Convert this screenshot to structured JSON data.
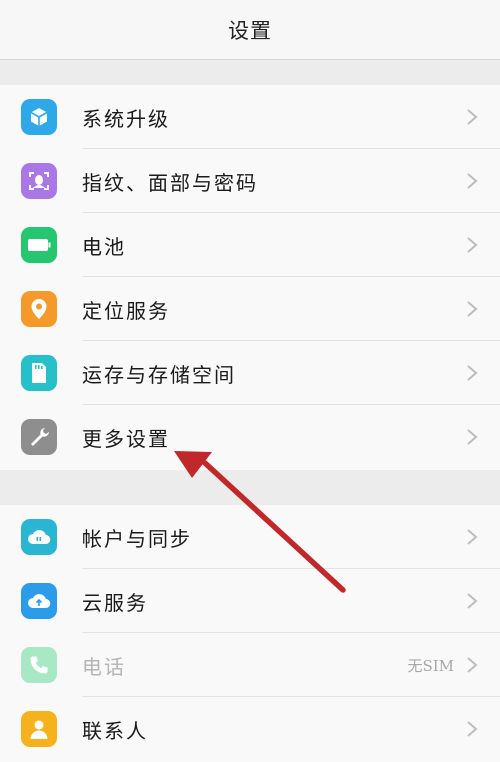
{
  "header": {
    "title": "设置"
  },
  "group1": [
    {
      "key": "system-upgrade",
      "label": "系统升级",
      "icon": "cube-icon",
      "color": "#2fa8ea"
    },
    {
      "key": "fingerprint",
      "label": "指纹、面部与密码",
      "icon": "face-scan-icon",
      "color": "#a978e6"
    },
    {
      "key": "battery",
      "label": "电池",
      "icon": "battery-icon",
      "color": "#25c66f"
    },
    {
      "key": "location",
      "label": "定位服务",
      "icon": "location-pin-icon",
      "color": "#f39a2a"
    },
    {
      "key": "storage",
      "label": "运存与存储空间",
      "icon": "sd-card-icon",
      "color": "#27c0c9"
    },
    {
      "key": "more-settings",
      "label": "更多设置",
      "icon": "wrench-icon",
      "color": "#8e8e8e"
    }
  ],
  "group2": [
    {
      "key": "accounts-sync",
      "label": "帐户与同步",
      "icon": "cloud-sync-icon",
      "color": "#2ab6d3"
    },
    {
      "key": "cloud-service",
      "label": "云服务",
      "icon": "cloud-icon",
      "color": "#2c9bea"
    },
    {
      "key": "phone",
      "label": "电话",
      "icon": "phone-icon",
      "color": "#a9e8c4",
      "value": "无SIM",
      "disabled": true
    },
    {
      "key": "contacts",
      "label": "联系人",
      "icon": "contact-icon",
      "color": "#f5b21c"
    }
  ],
  "annotation": {
    "arrow_color": "#c0282a",
    "points_to": "更多设置"
  }
}
